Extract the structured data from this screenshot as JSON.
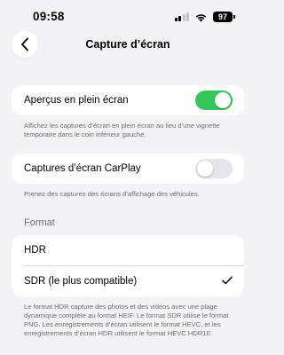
{
  "status_bar": {
    "time": "09:58",
    "battery": "97",
    "signal_bars_active": 2,
    "signal_bars_total": 4
  },
  "nav": {
    "title": "Capture d’écran",
    "back_icon": "chevron-left-icon"
  },
  "settings": {
    "fullscreen_preview": {
      "label": "Aperçus en plein écran",
      "enabled": true,
      "footer": "Affichez les captures d’écran en plein écran au lieu d’une vignette temporaire dans le coin inférieur gauche."
    },
    "carplay": {
      "label": "Captures d’écran CarPlay",
      "enabled": false,
      "footer": "Prenez des captures des écrans d’affichage des véhicules."
    },
    "format": {
      "header": "Format",
      "options": [
        {
          "label": "HDR",
          "selected": false
        },
        {
          "label": "SDR (le plus compatible)",
          "selected": true
        }
      ],
      "footer": "Le format HDR capture des photos et des vidéos avec une plage dynamique complète au format HEIF. Le format SDR utilise le format PNG. Les enregistrements d’écran utilisent le format HEVC, et les enregistrements d’écran HDR utilisent le format HEVC HDR10."
    }
  },
  "colors": {
    "background": "#f2f2f7",
    "toggle_on": "#34c759",
    "toggle_off": "#e5e5ea",
    "footer_text": "#6d6d72"
  }
}
